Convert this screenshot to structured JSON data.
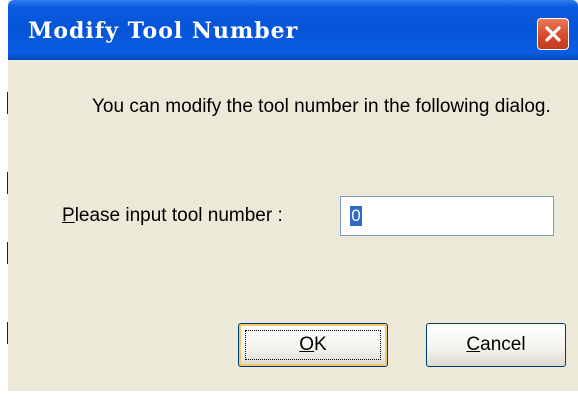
{
  "dialog": {
    "title": "Modify Tool Number",
    "message": "You can modify the tool number in the following dialog.",
    "input_label_prefix": "P",
    "input_label_rest": "lease input tool number :",
    "input_value": "0",
    "ok_label_prefix": "O",
    "ok_label_rest": "K",
    "cancel_label_prefix": "C",
    "cancel_label_rest": "ancel",
    "close_icon": "close-x-icon",
    "colors": {
      "titlebar": "#0654d8",
      "dialog_bg": "#ece9d8",
      "close_button": "#d64a2a",
      "selection": "#316ac5"
    }
  }
}
